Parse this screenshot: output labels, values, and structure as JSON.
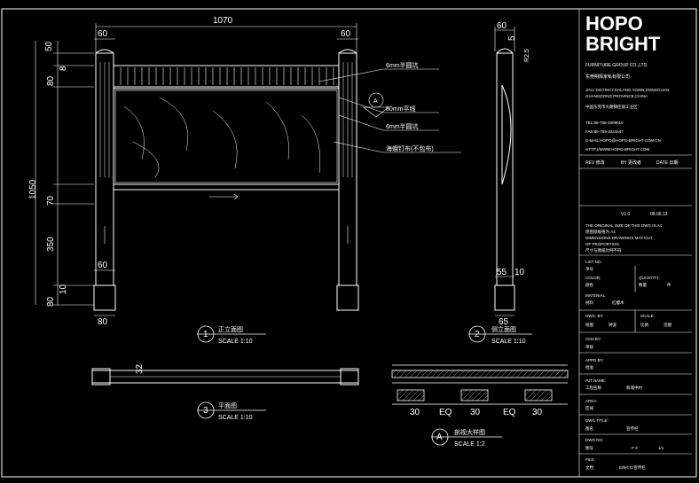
{
  "brand": {
    "logo_line1": "HOPO",
    "logo_line2": "BRIGHT",
    "group": "FURNITURE GROUP CO.,LTD.",
    "company_cn": "东莞明辉家私有限公司"
  },
  "company_info": {
    "addr_en1": "JIALI DISTRICT,DALANG TOWN,DONGGUAN",
    "addr_en2": "GUANGDONG PROVINCE,CHINA",
    "addr_cn": "中国东莞市大朗镇佳丽工业区",
    "tel": "TEL:86-769-3309010",
    "fax": "FAX:86-769-3321547",
    "email": "E-MAIL:HOPO@HOPO-BRIGHT.COM.CN",
    "web": "HTTP://WWW.HOPO-BRIGHT.COM"
  },
  "rev_row": {
    "no": "REV 修改",
    "by": "BY 更改者",
    "date": "DATE 日期"
  },
  "version": {
    "label": "V1.0",
    "date": "08.06.12"
  },
  "notes": [
    "THE ORIGINAL SIZE OF THIS DWG IS A4",
    "原图纸规格为 A4",
    "DIMENSIONS DRAWINGS MAY OUT",
    "OF PROPORTION",
    "尺寸与图纸比例不符"
  ],
  "fields": {
    "list_no": "LIST NO.",
    "list_no_cn": "单号",
    "color": "COLOR:",
    "color_cn": "颜色",
    "quantity": "QUANTITY:",
    "quantity_cn": "数量",
    "quantity_unit": "件",
    "material": "MATERIAL:",
    "material_cn": "材料",
    "material_value": "红樱木",
    "dwg_by": "DWG. BY:",
    "dwg_by_cn": "绘图",
    "dwg_by_value": "钟波",
    "scale": "SCALE:",
    "scale_cn": "比例",
    "scale_value": "见图",
    "ckd_by": "CKD.BY:",
    "ckd_by_cn": "审核",
    "appd": "APPD BY:",
    "appd_cn": "批准",
    "pjt": "PJT.NAME:",
    "pjt_cn": "工程名称",
    "pjt_value": "新城中村",
    "area": "AREA:",
    "area_cn": "区域",
    "title": "DWG.TITLE:",
    "title_cn": "图名",
    "title_value": "宣传栏",
    "dwg_no": "DWG.NO:",
    "dwg_no_cn": "图号",
    "dwg_no_value": "F-3",
    "sheet": "1/1",
    "file": "FILE:",
    "file_cn": "文档",
    "file_value": "E/B/CC/宣传栏"
  },
  "drawing": {
    "front": {
      "title": "正立面图",
      "scale": "SCALE 1:10",
      "number": "1",
      "dims": {
        "width": "1070",
        "post_l": "60",
        "post_r": "60",
        "h_total": "1050",
        "d50": "50",
        "d80a": "80",
        "d20": "20",
        "d8": "8",
        "d70": "70",
        "d15": "15",
        "d350": "350",
        "d60b": "60",
        "d10": "10",
        "d80b": "80",
        "base": "80"
      },
      "callouts": [
        "6mm半圆坑",
        "80mm平线",
        "6mm半圆坑",
        "海蛾钉布(不包布)"
      ],
      "detail_ref": "A"
    },
    "side": {
      "title": "侧立面图",
      "scale": "SCALE 1:10",
      "number": "2",
      "dims": {
        "top": "60",
        "d5": "5",
        "r": "R2.5",
        "d55": "55",
        "d10": "10",
        "base": "65"
      }
    },
    "plan": {
      "title": "平面图",
      "scale": "SCALE 1:10",
      "number": "3",
      "dims": {
        "d32": "32"
      }
    },
    "detail": {
      "title": "剖视大样图",
      "scale": "SCALE 1:2",
      "number": "A",
      "dims": [
        "30",
        "EQ",
        "30",
        "EQ",
        "30"
      ]
    }
  }
}
